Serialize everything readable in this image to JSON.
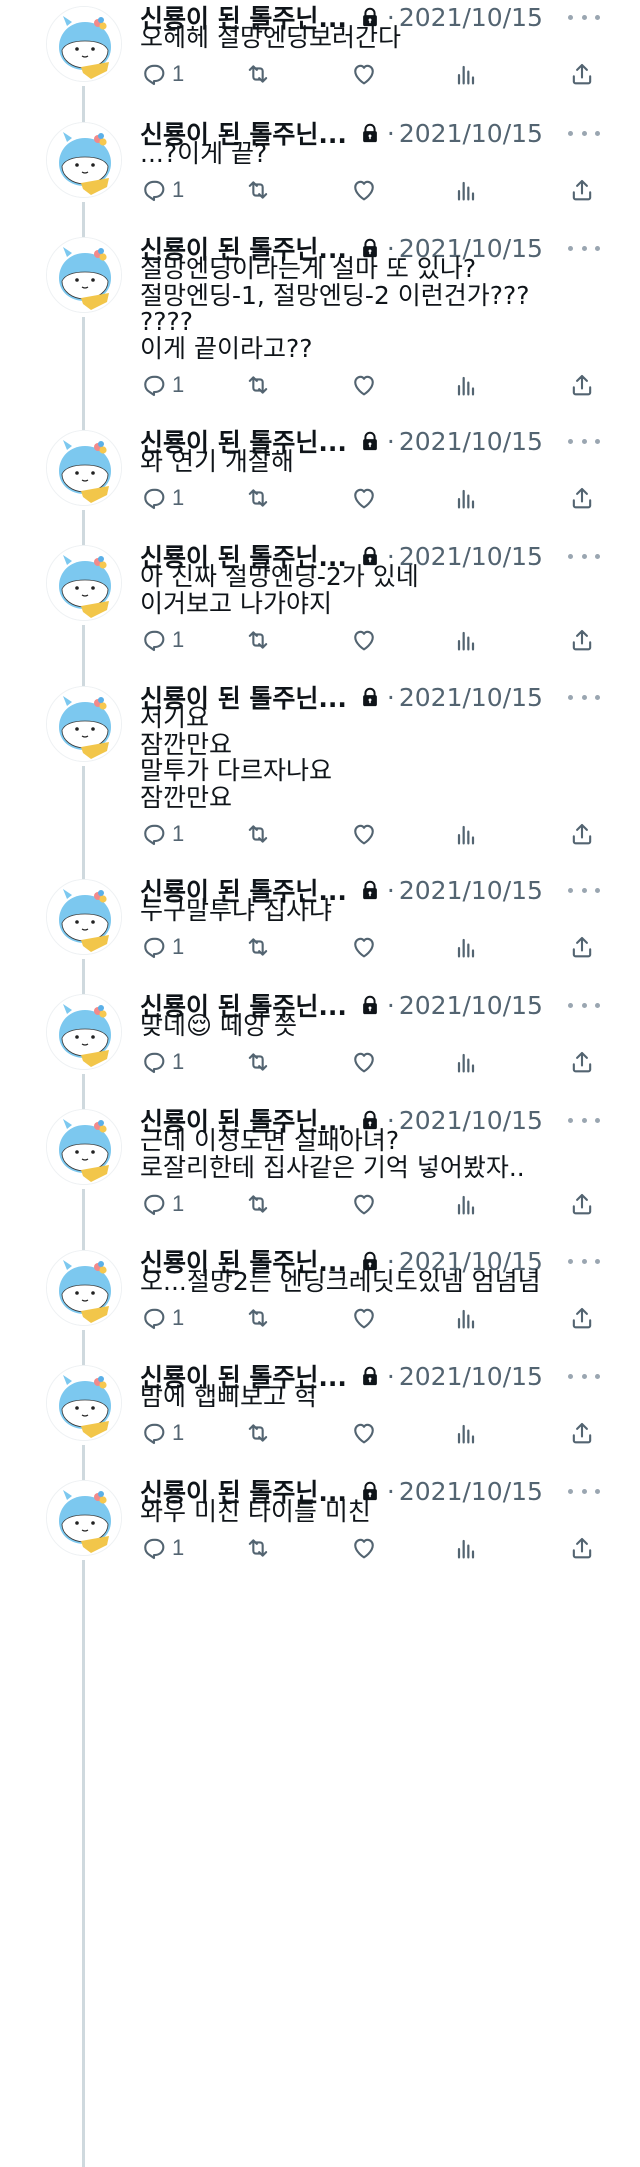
{
  "colors": {
    "text": "#0f1419",
    "secondary": "#536471",
    "thread_line": "#cfd9de",
    "icon": "#536471"
  },
  "icons": {
    "reply": "speech-bubble-icon",
    "retweet": "retweet-arrows-icon",
    "like": "heart-icon",
    "views": "bar-chart-icon",
    "share": "share-upload-icon",
    "lock": "lock-icon",
    "more": "ellipsis-icon"
  },
  "tweets": [
    {
      "author": "신룡이 된 톨주닌...",
      "separator": "·",
      "date": "2021/10/15",
      "lines": [
        "오헤헤 절망엔딩보러간다"
      ],
      "reply_count": "1"
    },
    {
      "author": "신룡이 된 톨주닌...",
      "separator": "·",
      "date": "2021/10/15",
      "lines": [
        "...?이게 끝?"
      ],
      "reply_count": "1"
    },
    {
      "author": "신룡이 된 톨주닌...",
      "separator": "·",
      "date": "2021/10/15",
      "lines": [
        "절망엔딩이라는게 설마 또 있나?",
        "절망엔딩-1, 절망엔딩-2 이런건가???",
        "????",
        "이게 끝이라고??"
      ],
      "reply_count": "1"
    },
    {
      "author": "신룡이 된 톨주닌...",
      "separator": "·",
      "date": "2021/10/15",
      "lines": [
        "와 연기 개잘해"
      ],
      "reply_count": "1"
    },
    {
      "author": "신룡이 된 톨주닌...",
      "separator": "·",
      "date": "2021/10/15",
      "lines": [
        "아 진짜 절망엔딩-2가 있네",
        "이거보고 나가야지"
      ],
      "reply_count": "1"
    },
    {
      "author": "신룡이 된 톨주닌...",
      "separator": "·",
      "date": "2021/10/15",
      "lines": [
        "저기요",
        "잠깐만요",
        "말투가 다르자나요",
        "잠깐만요"
      ],
      "reply_count": "1"
    },
    {
      "author": "신룡이 된 톨주닌...",
      "separator": "·",
      "date": "2021/10/15",
      "lines": [
        "누구말투냐 집사냐"
      ],
      "reply_count": "1"
    },
    {
      "author": "신룡이 된 톨주닌...",
      "separator": "·",
      "date": "2021/10/15",
      "lines": [
        "맞네😌 떼잉 쯧"
      ],
      "reply_count": "1"
    },
    {
      "author": "신룡이 된 톨주닌...",
      "separator": "·",
      "date": "2021/10/15",
      "lines": [
        "근데 이정도면 실패아녀?",
        "로잘리한테 집사같은 기억 넣어봤자.."
      ],
      "reply_count": "1"
    },
    {
      "author": "신룡이 된 톨주닌...",
      "separator": "·",
      "date": "2021/10/15",
      "lines": [
        "오...절망2는 엔딩크레딧도있넴 엄념념"
      ],
      "reply_count": "1"
    },
    {
      "author": "신룡이 된 톨주닌...",
      "separator": "·",
      "date": "2021/10/15",
      "lines": [
        "밤에 햅삐보고 헉"
      ],
      "reply_count": "1"
    },
    {
      "author": "신룡이 된 톨주닌...",
      "separator": "·",
      "date": "2021/10/15",
      "lines": [
        "와우 미친 타이틀 미친"
      ],
      "reply_count": "1"
    }
  ]
}
